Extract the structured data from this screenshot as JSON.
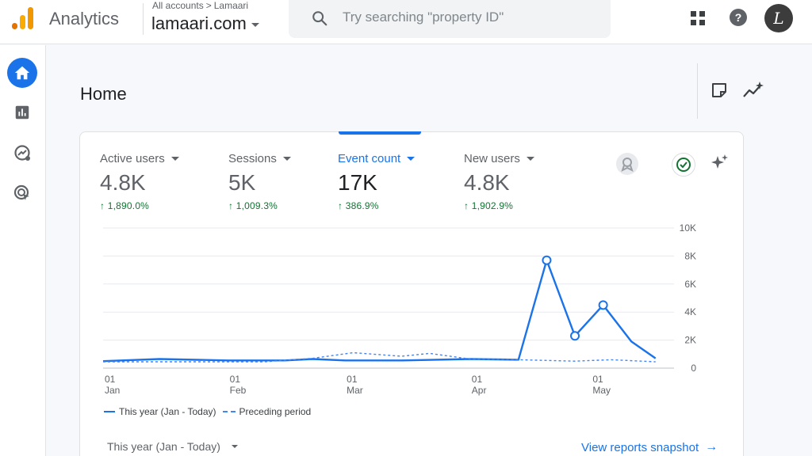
{
  "header": {
    "app_title": "Analytics",
    "breadcrumb": [
      "All accounts",
      "Lamaari"
    ],
    "property": "lamaari.com",
    "search_placeholder": "Try searching \"property ID\"",
    "avatar_initial": "L"
  },
  "rail": {
    "items": [
      {
        "name": "Home",
        "icon": "home-icon",
        "active": true
      },
      {
        "name": "Reports",
        "icon": "bar-chart-icon",
        "active": false
      },
      {
        "name": "Explore",
        "icon": "explore-icon",
        "active": false
      },
      {
        "name": "Advertising",
        "icon": "advertising-icon",
        "active": false
      }
    ]
  },
  "main": {
    "title": "Home",
    "metrics": [
      {
        "label": "Active users",
        "value": "4.8K",
        "change": "1,890.0%",
        "active": false
      },
      {
        "label": "Sessions",
        "value": "5K",
        "change": "1,009.3%",
        "active": false
      },
      {
        "label": "Event count",
        "value": "17K",
        "change": "386.9%",
        "active": true
      },
      {
        "label": "New users",
        "value": "4.8K",
        "change": "1,902.9%",
        "active": false
      }
    ],
    "legend": {
      "this_year": "This year (Jan - Today)",
      "preceding": "Preceding period"
    },
    "period_select": "This year (Jan - Today)",
    "snapshot_link": "View reports snapshot"
  },
  "colors": {
    "accent": "#1a73e8",
    "positive": "#137333",
    "logo_orange": "#f9ab00",
    "logo_dark": "#e37400"
  },
  "chart_data": {
    "type": "line",
    "x_ticks": [
      {
        "day": "01",
        "month": "Jan"
      },
      {
        "day": "01",
        "month": "Feb"
      },
      {
        "day": "01",
        "month": "Mar"
      },
      {
        "day": "01",
        "month": "Apr"
      },
      {
        "day": "01",
        "month": "May"
      }
    ],
    "y_ticks": [
      "10K",
      "8K",
      "6K",
      "4K",
      "2K",
      "0"
    ],
    "ylim": [
      0,
      10000
    ],
    "series": [
      {
        "name": "This year (Jan - Today)",
        "style": "solid",
        "points": [
          [
            "2024-01-01",
            500
          ],
          [
            "2024-01-15",
            650
          ],
          [
            "2024-02-01",
            550
          ],
          [
            "2024-02-15",
            550
          ],
          [
            "2024-02-22",
            650
          ],
          [
            "2024-03-01",
            550
          ],
          [
            "2024-03-15",
            550
          ],
          [
            "2024-04-01",
            650
          ],
          [
            "2024-04-13",
            600
          ],
          [
            "2024-04-20",
            7700
          ],
          [
            "2024-04-27",
            2300
          ],
          [
            "2024-05-04",
            4500
          ],
          [
            "2024-05-11",
            1900
          ],
          [
            "2024-05-17",
            700
          ]
        ],
        "markers": [
          "2024-04-20",
          "2024-04-27",
          "2024-05-04"
        ]
      },
      {
        "name": "Preceding period",
        "style": "dashed",
        "points": [
          [
            "2024-01-01",
            450
          ],
          [
            "2024-01-20",
            450
          ],
          [
            "2024-02-10",
            450
          ],
          [
            "2024-02-22",
            700
          ],
          [
            "2024-03-03",
            1100
          ],
          [
            "2024-03-15",
            850
          ],
          [
            "2024-03-22",
            1050
          ],
          [
            "2024-04-01",
            650
          ],
          [
            "2024-04-13",
            600
          ],
          [
            "2024-04-27",
            500
          ],
          [
            "2024-05-06",
            600
          ],
          [
            "2024-05-17",
            450
          ]
        ]
      }
    ]
  }
}
